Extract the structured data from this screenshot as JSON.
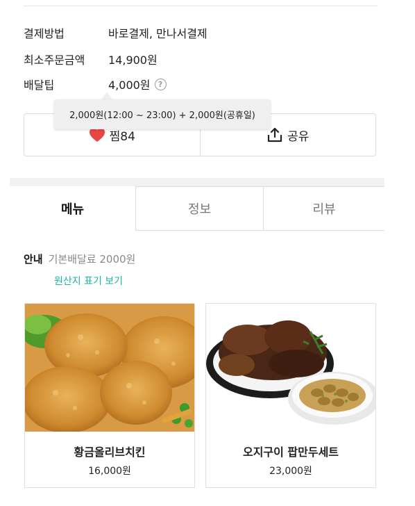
{
  "store_info": {
    "payment_label": "결제방법",
    "payment_value": "바로결제, 만나서결제",
    "min_order_label": "최소주문금액",
    "min_order_value": "14,900원",
    "delivery_tip_label": "배달팁",
    "delivery_tip_value": "4,000원",
    "help_icon": "?"
  },
  "tooltip": {
    "text": "2,000원(12:00 ~ 23:00) + 2,000원(공휴일)"
  },
  "actions": {
    "like_label": "찜84",
    "share_label": "공유",
    "like_color": "#e84545"
  },
  "tabs": [
    {
      "label": "메뉴",
      "active": true
    },
    {
      "label": "정보",
      "active": false
    },
    {
      "label": "리뷰",
      "active": false
    }
  ],
  "notice": {
    "label": "안내",
    "text": "기본배달료 2000원",
    "origin_link": "원산지 표기 보기",
    "link_color": "#19b5a6"
  },
  "menu_items": [
    {
      "name": "황금올리브치킨",
      "price": "16,000원",
      "image": "fried-chicken-photo"
    },
    {
      "name": "오지구이 팝만두세트",
      "price": "23,000원",
      "image": "roasted-chicken-dumpling-photo"
    }
  ]
}
